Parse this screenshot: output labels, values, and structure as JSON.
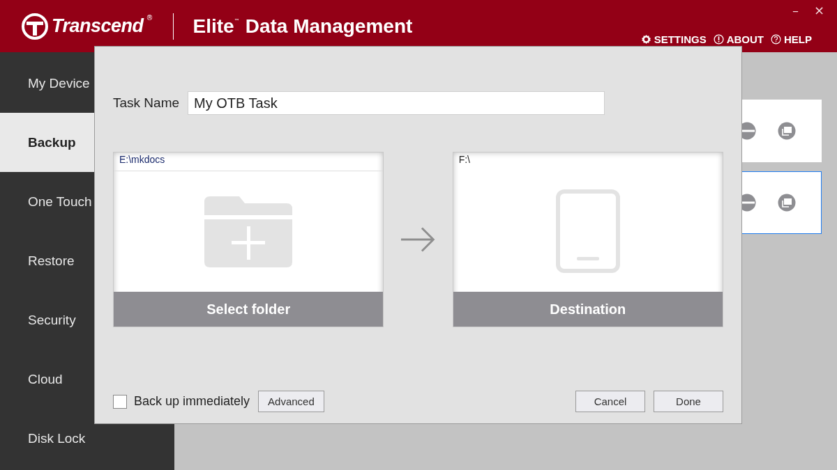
{
  "header": {
    "brand": "Transcend",
    "brand_mark": "®",
    "product": "Elite",
    "product_mark": "™",
    "product_name": "Data Management",
    "window_controls": [
      "–",
      "×"
    ],
    "links": [
      {
        "kind": "settings",
        "label": "SETTINGS"
      },
      {
        "kind": "about",
        "label": "ABOUT"
      },
      {
        "kind": "help",
        "label": "HELP"
      }
    ]
  },
  "sidebar": {
    "items": [
      {
        "label": "My Device",
        "selected": false
      },
      {
        "label": "Backup",
        "selected": true
      },
      {
        "label": "One Touch",
        "selected": false
      },
      {
        "label": "Restore",
        "selected": false
      },
      {
        "label": "Security",
        "selected": false
      },
      {
        "label": "Cloud",
        "selected": false
      },
      {
        "label": "Disk Lock",
        "selected": false
      }
    ]
  },
  "tasks": [
    {
      "selected": false
    },
    {
      "selected": true
    }
  ],
  "dialog": {
    "task_name_label": "Task Name",
    "task_name": "My OTB Task",
    "source": {
      "path": "E:\\mkdocs",
      "button": "Select folder"
    },
    "destination": {
      "path": "F:\\",
      "button": "Destination"
    },
    "backup_immediately": {
      "label": "Back up immediately",
      "checked": false
    },
    "buttons": {
      "advanced": "Advanced",
      "cancel": "Cancel",
      "done": "Done"
    }
  }
}
